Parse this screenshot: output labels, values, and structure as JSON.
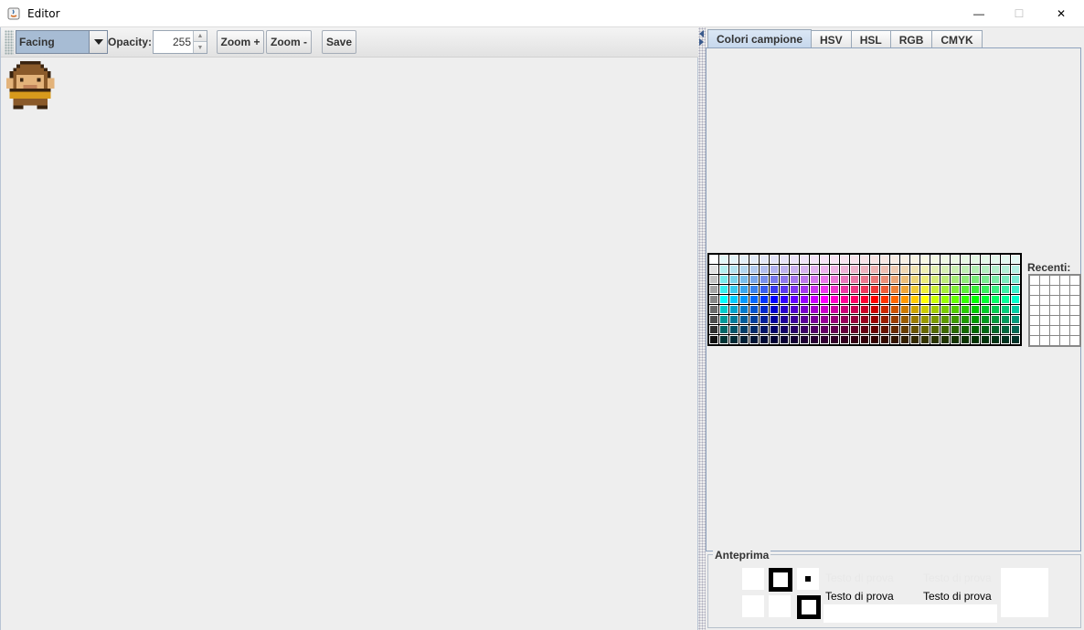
{
  "window": {
    "title": "Editor",
    "minimize_glyph": "—",
    "maximize_glyph": "☐",
    "close_glyph": "✕"
  },
  "toolbar": {
    "facing_value": "Facing",
    "opacity_label": "Opacity:",
    "opacity_value": "255",
    "zoom_in_label": "Zoom +",
    "zoom_out_label": "Zoom -",
    "save_label": "Save"
  },
  "color_chooser": {
    "tabs": [
      {
        "label": "Colori campione",
        "active": true
      },
      {
        "label": "HSV",
        "active": false
      },
      {
        "label": "HSL",
        "active": false
      },
      {
        "label": "RGB",
        "active": false
      },
      {
        "label": "CMYK",
        "active": false
      }
    ],
    "recent_label": "Recenti:",
    "preview_label": "Anteprima",
    "preview_text": "Testo di prova"
  },
  "colors": {
    "selection": "#a7bcd4",
    "tab_active": "#c5d7ec",
    "sprite_outline": "#3a2410",
    "sprite_fur": "#8a5a2a",
    "sprite_face": "#e3b37a",
    "sprite_belt": "#d89a1c"
  }
}
